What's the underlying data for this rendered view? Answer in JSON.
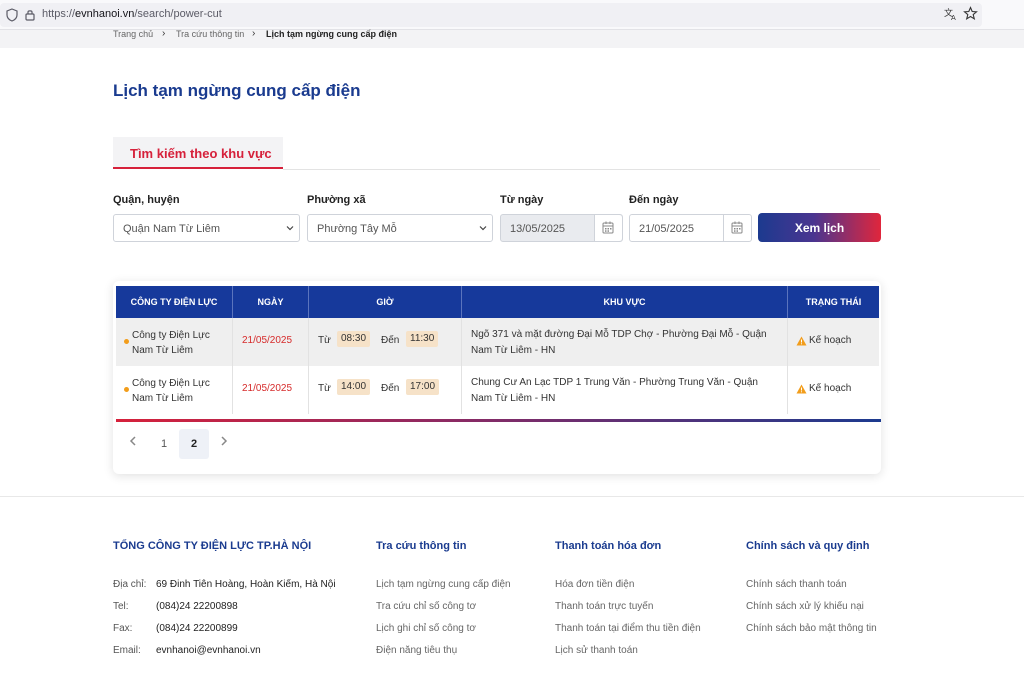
{
  "browser": {
    "url_prefix": "https://",
    "url_host": "evnhanoi.vn",
    "url_path": "/search/power-cut",
    "icons": [
      "shield-icon",
      "lock-icon",
      "translate-icon",
      "star-icon"
    ]
  },
  "breadcrumb": {
    "home": "Trang chủ",
    "section": "Tra cứu thông tin",
    "current": "Lịch tạm ngừng cung cấp điện"
  },
  "page_title": "Lịch tạm ngừng cung cấp điện",
  "tabs": [
    {
      "label": "Tìm kiếm theo khu vực",
      "active": true
    }
  ],
  "form": {
    "district_label": "Quận, huyện",
    "district_value": "Quận Nam Từ Liêm",
    "ward_label": "Phường xã",
    "ward_value": "Phường Tây Mỗ",
    "from_label": "Từ ngày",
    "from_value": "13/05/2025",
    "to_label": "Đến ngày",
    "to_value": "21/05/2025",
    "submit_label": "Xem lịch"
  },
  "table": {
    "headers": [
      "CÔNG TY ĐIỆN LỰC",
      "NGÀY",
      "GIỜ",
      "KHU VỰC",
      "TRẠNG THÁI"
    ],
    "from_word": "Từ",
    "to_word": "Đến",
    "rows": [
      {
        "company": "Công ty Điện Lực Nam Từ Liêm",
        "date": "21/05/2025",
        "start": "08:30",
        "end": "11:30",
        "area": "Ngõ 371 và mặt đường Đại Mỗ TDP Chợ - Phường Đại Mỗ - Quận Nam Từ Liêm - HN",
        "status": "Kế hoạch"
      },
      {
        "company": "Công ty Điện Lực Nam Từ Liêm",
        "date": "21/05/2025",
        "start": "14:00",
        "end": "17:00",
        "area": "Chung Cư An Lạc TDP 1 Trung Văn - Phường Trung Văn - Quận Nam Từ Liêm - HN",
        "status": "Kế hoạch"
      }
    ]
  },
  "pagination": {
    "pages": [
      "1",
      "2"
    ],
    "current": "2"
  },
  "footer": {
    "company": {
      "title": "TỔNG CÔNG TY ĐIỆN LỰC TP.HÀ NỘI",
      "address_label": "Địa chỉ:",
      "address": "69 Đinh Tiên Hoàng, Hoàn Kiếm, Hà Nội",
      "tel_label": "Tel:",
      "tel": "(084)24 22200898",
      "fax_label": "Fax:",
      "fax": "(084)24 22200899",
      "email_label": "Email:",
      "email": "evnhanoi@evnhanoi.vn"
    },
    "lookup": {
      "title": "Tra cứu thông tin",
      "links": [
        "Lịch tạm ngừng cung cấp điện",
        "Tra cứu chỉ số công tơ",
        "Lịch ghi chỉ số công tơ",
        "Điện năng tiêu thụ"
      ]
    },
    "payment": {
      "title": "Thanh toán hóa đơn",
      "links": [
        "Hóa đơn tiền điện",
        "Thanh toán trực tuyến",
        "Thanh toán tại điểm thu tiền điện",
        "Lịch sử thanh toán"
      ]
    },
    "policy": {
      "title": "Chính sách và quy định",
      "links": [
        "Chính sách thanh toán",
        "Chính sách xử lý khiếu nại",
        "Chính sách bảo mật thông tin"
      ]
    }
  },
  "colors": {
    "primary_blue": "#16399b",
    "accent_red": "#d6213b",
    "time_chip": "#f6e2c8",
    "status_dot": "#f29d1b"
  }
}
